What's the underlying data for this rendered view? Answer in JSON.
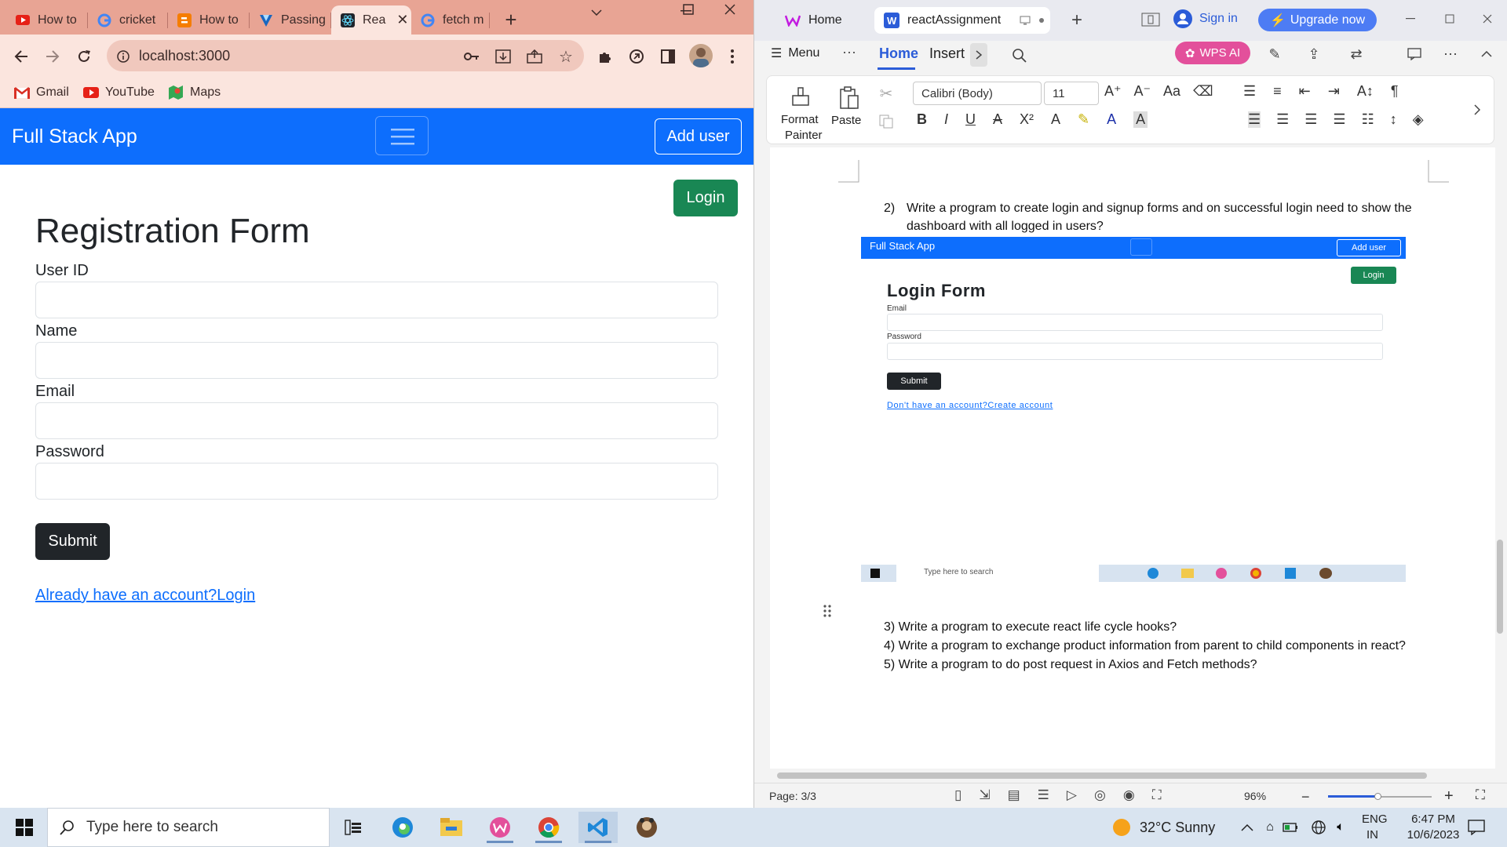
{
  "browser": {
    "tabs": [
      {
        "label": "How to",
        "icon": "youtube-icon"
      },
      {
        "label": "cricket",
        "icon": "google-icon"
      },
      {
        "label": "How to",
        "icon": "blogger-icon"
      },
      {
        "label": "Passing",
        "icon": "vuetify-icon"
      },
      {
        "label": "Rea",
        "icon": "react-icon",
        "active": true
      },
      {
        "label": "fetch m",
        "icon": "google-icon"
      }
    ],
    "url": "localhost:3000",
    "bookmarks": [
      {
        "label": "Gmail",
        "icon": "gmail-icon"
      },
      {
        "label": "YouTube",
        "icon": "youtube-icon"
      },
      {
        "label": "Maps",
        "icon": "maps-icon"
      }
    ]
  },
  "app": {
    "brand": "Full Stack App",
    "add_user": "Add user",
    "login": "Login",
    "title": "Registration Form",
    "fields": [
      "User ID",
      "Name",
      "Email",
      "Password"
    ],
    "submit": "Submit",
    "link": "Already have an account?Login",
    "colors": {
      "navbar": "#0d6efd",
      "login": "#198754",
      "submit": "#212529"
    }
  },
  "wps": {
    "tabs": [
      {
        "label": "Home"
      },
      {
        "label": "reactAssignment"
      }
    ],
    "sign_in": "Sign in",
    "upgrade": "Upgrade now",
    "menu": {
      "menu": "Menu",
      "more": "···",
      "home": "Home",
      "insert": "Insert"
    },
    "wps_ai": "WPS AI",
    "ribbon": {
      "format_painter_1": "Format",
      "format_painter_2": "Painter",
      "paste": "Paste",
      "font": "Calibri (Body)",
      "size": "11"
    },
    "doc": {
      "q2_num": "2)",
      "q2_line1": "Write a program to create login and signup forms and on successful login need to show the",
      "q2_line2": "dashboard with all logged in users?",
      "q3": "3)   Write a program to execute react life cycle hooks?",
      "q4": "4)   Write a program to exchange product information from parent to child components in react?",
      "q5": "5)   Write a program to do post request in Axios and Fetch methods?"
    },
    "embedded": {
      "brand": "Full Stack App",
      "add_user": "Add user",
      "login": "Login",
      "title": "Login Form",
      "email": "Email",
      "password": "Password",
      "submit": "Submit",
      "link": "Don't have an account?Create account",
      "search": "Type here to search"
    },
    "status": {
      "page": "Page: 3/3",
      "zoom": "96%"
    }
  },
  "taskbar": {
    "search": "Type here to search",
    "weather": "32°C  Sunny",
    "lang1": "ENG",
    "lang2": "IN",
    "time": "6:47 PM",
    "date": "10/6/2023"
  }
}
